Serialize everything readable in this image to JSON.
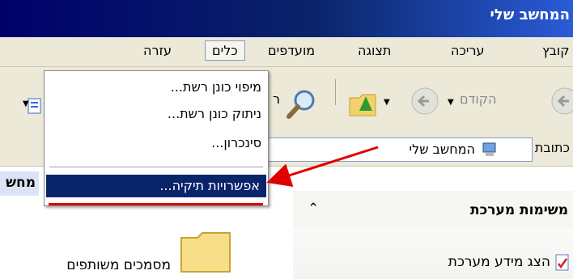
{
  "window": {
    "title": "המחשב שלי"
  },
  "menubar": {
    "items": [
      "עזרה",
      "כלים",
      "מועדפים",
      "תצוגה",
      "עריכה",
      "קובץ"
    ]
  },
  "toolbar": {
    "back_label": "הקודם"
  },
  "address": {
    "label": "כתובת",
    "value": "המחשב שלי"
  },
  "dropdown": {
    "items": [
      "מיפוי כונן רשת...",
      "ניתוק כונן רשת...",
      "סינכרון..."
    ],
    "highlighted": "אפשרויות תיקיה..."
  },
  "left_panel": {
    "header": "מחש",
    "folder_label": "מסמכים משותפים"
  },
  "task_panel": {
    "header": "משימות מערכת",
    "item": "הצג מידע מערכת"
  },
  "colors": {
    "title_bar": "#0a246a",
    "highlight": "#0a246a",
    "arrow": "#e00000",
    "window_bg": "#ece9d8"
  }
}
